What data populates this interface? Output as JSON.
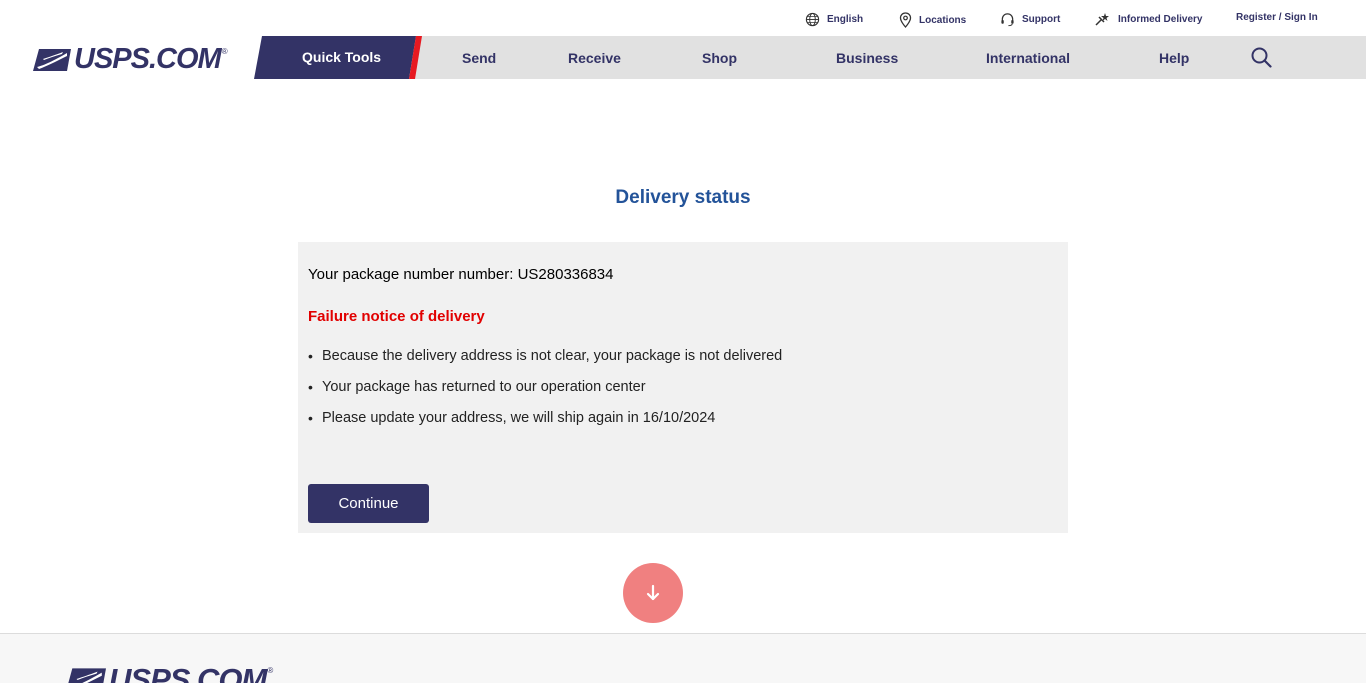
{
  "utility": {
    "language": "English",
    "locations": "Locations",
    "support": "Support",
    "informed_delivery": "Informed Delivery",
    "register": "Register / Sign In"
  },
  "logo": {
    "text": "USPS.COM",
    "reg": "®"
  },
  "nav": {
    "quick_tools": "Quick Tools",
    "send": "Send",
    "receive": "Receive",
    "shop": "Shop",
    "business": "Business",
    "international": "International",
    "help": "Help"
  },
  "main": {
    "title": "Delivery status",
    "package_line": "Your package number number: US280336834",
    "failure_heading": "Failure notice of delivery",
    "bullets": [
      "Because the delivery address is not clear, your package is not delivered",
      "Your package has returned to our operation center",
      "Please update your address, we will ship again in 16/10/2024"
    ],
    "continue_label": "Continue"
  },
  "footer": {
    "logo_text": "USPS.COM",
    "reg": "®"
  },
  "colors": {
    "brand_navy": "#333366",
    "title_blue": "#235399",
    "alert_red": "#e10000",
    "accent_red": "#e71921",
    "scroll_button": "#f08080"
  },
  "icons": {
    "language": "globe-icon",
    "locations": "location-pin-icon",
    "support": "headset-icon",
    "informed_delivery": "informed-delivery-icon",
    "search": "search-icon",
    "scroll": "arrow-down-icon",
    "logo": "eagle-logo-icon"
  }
}
